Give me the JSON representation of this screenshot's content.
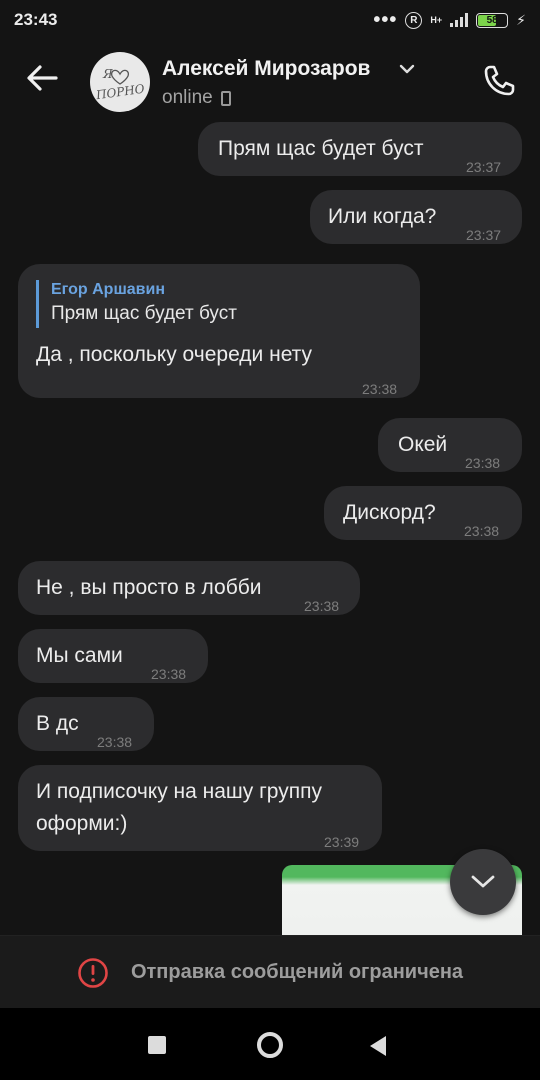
{
  "status_bar": {
    "time": "23:43",
    "dots": "•••",
    "r_badge": "R",
    "network": "H+",
    "battery": "58"
  },
  "header": {
    "name": "Алексей Мирозаров",
    "presence": "online",
    "avatar_text_1": "Я",
    "avatar_text_2": "ПОРНО"
  },
  "messages": [
    {
      "side": "out",
      "text": "Прям щас будет буст",
      "time": "23:37"
    },
    {
      "side": "out",
      "text": "Или когда?",
      "time": "23:37"
    },
    {
      "side": "in",
      "reply_author": "Егор Аршавин",
      "reply_text": "Прям щас будет буст",
      "text": "Да , поскольку очереди нету",
      "time": "23:38"
    },
    {
      "side": "out",
      "text": "Окей",
      "time": "23:38"
    },
    {
      "side": "out",
      "text": "Дискорд?",
      "time": "23:38"
    },
    {
      "side": "in",
      "text": "Не , вы просто в лобби",
      "time": "23:38"
    },
    {
      "side": "in",
      "text": "Мы сами",
      "time": "23:38"
    },
    {
      "side": "in",
      "text": "В дс",
      "time": "23:38"
    },
    {
      "side": "in",
      "text_line1": "И подписочку на нашу группу",
      "text_line2": "оформи:)",
      "time": "23:39"
    }
  ],
  "banner": {
    "text": "Отправка сообщений ограничена"
  },
  "colors": {
    "background": "#141414",
    "bubble": "#2c2c2e",
    "accent": "#5d9bd8",
    "warning": "#e04545"
  }
}
